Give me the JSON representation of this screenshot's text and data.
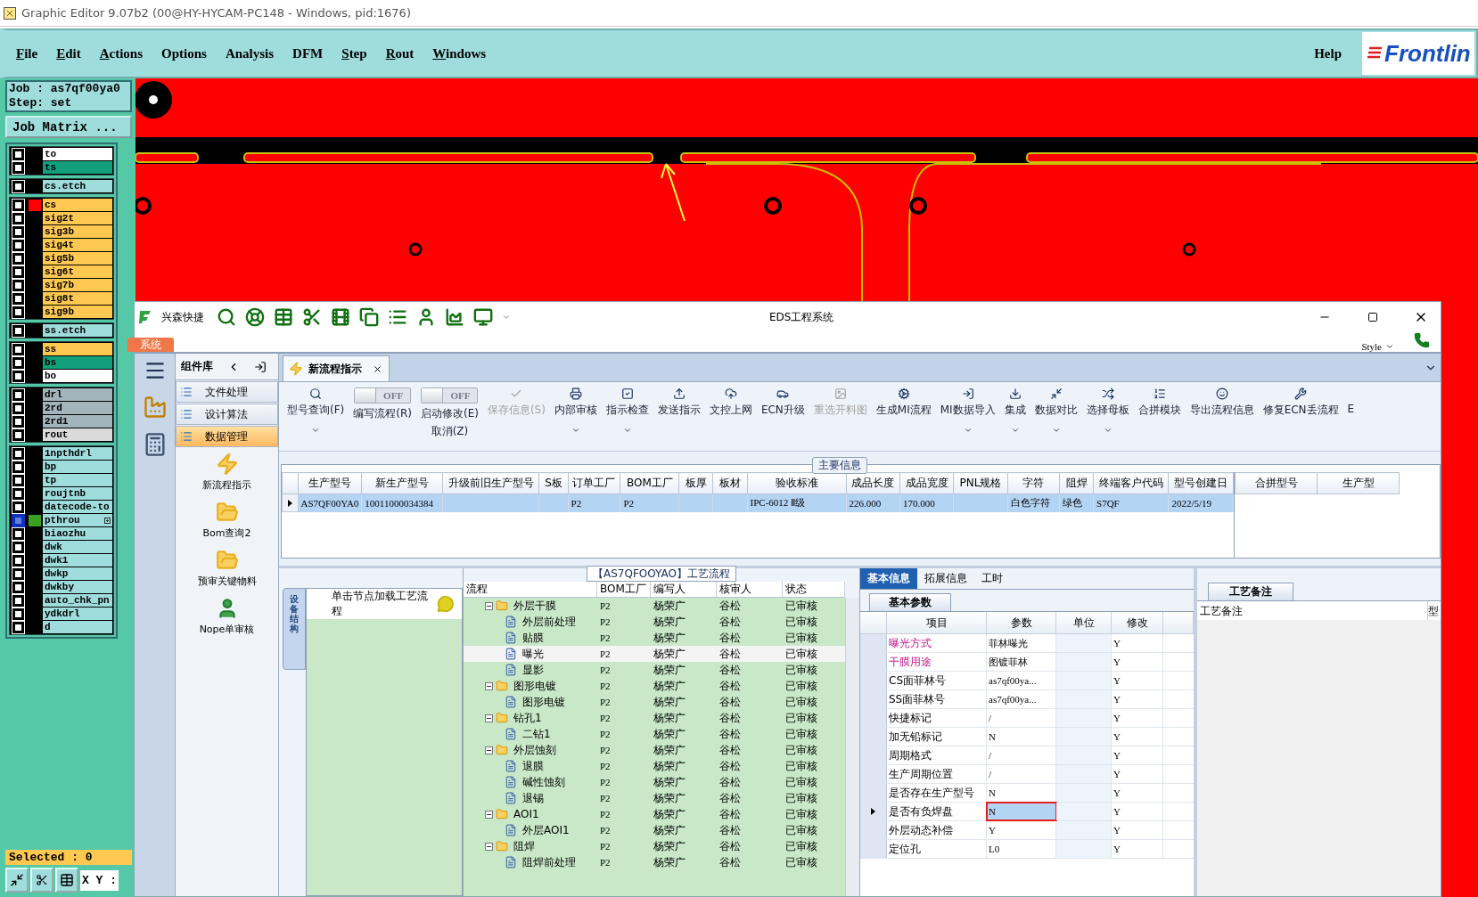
{
  "window": {
    "title": "Graphic Editor 9.07b2 (00@HY-HYCAM-PC148 - Windows, pid:1676)"
  },
  "menu": [
    {
      "label": "File",
      "mnemonic": true
    },
    {
      "label": "Edit",
      "mnemonic": true
    },
    {
      "label": "Actions",
      "mnemonic": true
    },
    {
      "label": "Options",
      "mnemonic": false
    },
    {
      "label": "Analysis",
      "mnemonic": false
    },
    {
      "label": "DFM",
      "mnemonic": false
    },
    {
      "label": "Step",
      "mnemonic": true
    },
    {
      "label": "Rout",
      "mnemonic": true
    },
    {
      "label": "Windows",
      "mnemonic": true
    }
  ],
  "help": "Help",
  "logo_text": "Frontlin",
  "job": {
    "job": "Job : as7qf00ya0",
    "step": "Step: set",
    "matrix_button": "Job Matrix ..."
  },
  "layer_groups": [
    {
      "layers": [
        {
          "name": "to",
          "color": "#ffffff",
          "selected": false
        },
        {
          "name": "ts",
          "color": "#12a07c",
          "selected": false
        }
      ]
    },
    {
      "layers": [
        {
          "name": "cs.etch",
          "color": "#9fdcdc",
          "selected": false
        }
      ]
    },
    {
      "layers": [
        {
          "name": "cs",
          "color": "#ffc850",
          "selected": false,
          "marker": {
            "color": "#ff0000"
          }
        },
        {
          "name": "sig2t",
          "color": "#ffc850",
          "selected": false
        },
        {
          "name": "sig3b",
          "color": "#ffc850",
          "selected": false
        },
        {
          "name": "sig4t",
          "color": "#ffc850",
          "selected": false
        },
        {
          "name": "sig5b",
          "color": "#ffc850",
          "selected": false
        },
        {
          "name": "sig6t",
          "color": "#ffc850",
          "selected": false
        },
        {
          "name": "sig7b",
          "color": "#ffc850",
          "selected": false
        },
        {
          "name": "sig8t",
          "color": "#ffc850",
          "selected": false
        },
        {
          "name": "sig9b",
          "color": "#ffc850",
          "selected": false
        }
      ]
    },
    {
      "layers": [
        {
          "name": "ss.etch",
          "color": "#9fdcdc",
          "selected": false
        }
      ]
    },
    {
      "layers": [
        {
          "name": "ss",
          "color": "#ffc850",
          "selected": false
        },
        {
          "name": "bs",
          "color": "#12a07c",
          "selected": false
        },
        {
          "name": "bo",
          "color": "#ffffff",
          "selected": false
        }
      ]
    },
    {
      "layers": [
        {
          "name": "drl",
          "color": "#a4b4bc",
          "selected": false
        },
        {
          "name": "2rd",
          "color": "#a4b4bc",
          "selected": false
        },
        {
          "name": "2rd1",
          "color": "#a4b4bc",
          "selected": false
        },
        {
          "name": "rout",
          "color": "#dadada",
          "selected": false
        }
      ]
    },
    {
      "layers": [
        {
          "name": "1npthdrl",
          "color": "#9fdcdc",
          "selected": false
        },
        {
          "name": "bp",
          "color": "#9fdcdc",
          "selected": false
        },
        {
          "name": "tp",
          "color": "#9fdcdc",
          "selected": false
        },
        {
          "name": "roujtnb",
          "color": "#9fdcdc",
          "selected": false
        },
        {
          "name": "datecode-to",
          "color": "#9fdcdc",
          "selected": false
        },
        {
          "name": "pthrou",
          "color": "#9fdcdc",
          "selected": true,
          "marker": {
            "color": "#3aa020"
          }
        },
        {
          "name": "biaozhu",
          "color": "#9fdcdc",
          "selected": false
        },
        {
          "name": "dwk",
          "color": "#9fdcdc",
          "selected": false
        },
        {
          "name": "dwk1",
          "color": "#9fdcdc",
          "selected": false
        },
        {
          "name": "dwkp",
          "color": "#9fdcdc",
          "selected": false
        },
        {
          "name": "dwkby",
          "color": "#9fdcdc",
          "selected": false
        },
        {
          "name": "auto_chk_pn",
          "color": "#9fdcdc",
          "selected": false
        },
        {
          "name": "ydkdrl",
          "color": "#9fdcdc",
          "selected": false
        },
        {
          "name": "d",
          "color": "#9fdcdc",
          "selected": false
        }
      ]
    }
  ],
  "selected_count": "Selected : 0",
  "xy_label": "X Y :",
  "eds": {
    "title": "EDS工程系统",
    "quick_access": "兴森快捷",
    "system_tab": "系统",
    "style_menu": "Style",
    "component_panel": {
      "title": "组件库",
      "categories": [
        {
          "label": "文件处理",
          "selected": false
        },
        {
          "label": "设计算法",
          "selected": false
        },
        {
          "label": "数据管理",
          "selected": true
        }
      ],
      "tools": [
        {
          "label": "新流程指示"
        },
        {
          "label": "Bom查询2"
        },
        {
          "label": "预审关键物料"
        },
        {
          "label": "Nope单审核"
        }
      ]
    },
    "doc_tab": {
      "label": "新流程指示"
    },
    "ribbon": [
      {
        "kind": "button",
        "label": "型号查询(F)",
        "disabled": false,
        "dropdown": true
      },
      {
        "kind": "toggle",
        "label": "编写流程(R)",
        "toggle_text": "OFF",
        "on": false
      },
      {
        "kind": "toggle",
        "label": "启动修改(E)",
        "label2": "取消(Z)",
        "toggle_text": "OFF",
        "on": false
      },
      {
        "kind": "button",
        "label": "保存信息(S)",
        "disabled": true,
        "dropdown": false
      },
      {
        "kind": "button",
        "label": "内部审核",
        "disabled": false,
        "dropdown": true
      },
      {
        "kind": "button",
        "label": "指示检查",
        "disabled": false,
        "dropdown": true
      },
      {
        "kind": "button",
        "label": "发送指示",
        "disabled": false,
        "dropdown": false
      },
      {
        "kind": "button",
        "label": "文控上网",
        "disabled": false,
        "dropdown": false
      },
      {
        "kind": "button",
        "label": "ECN升级",
        "disabled": false,
        "dropdown": false
      },
      {
        "kind": "button",
        "label": "重选开料图",
        "disabled": true,
        "dropdown": false
      },
      {
        "kind": "button",
        "label": "生成MI流程",
        "disabled": false,
        "dropdown": false
      },
      {
        "kind": "button",
        "label": "MI数据导入",
        "disabled": false,
        "dropdown": true
      },
      {
        "kind": "button",
        "label": "集成",
        "disabled": false,
        "dropdown": true
      },
      {
        "kind": "button",
        "label": "数据对比",
        "disabled": false,
        "dropdown": true
      },
      {
        "kind": "button",
        "label": "选择母板",
        "disabled": false,
        "dropdown": true
      },
      {
        "kind": "button",
        "label": "合拼模块",
        "disabled": false,
        "dropdown": false
      },
      {
        "kind": "button",
        "label": "导出流程信息",
        "disabled": false,
        "dropdown": false
      },
      {
        "kind": "button",
        "label": "修复ECN丢流程",
        "disabled": false,
        "dropdown": false
      },
      {
        "kind": "button",
        "label": "E",
        "disabled": false,
        "dropdown": false
      }
    ],
    "main_info": {
      "title": "主要信息",
      "columns": [
        "生产型号",
        "新生产型号",
        "升级前旧生产型号",
        "S板",
        "订单工厂",
        "BOM工厂",
        "板厚",
        "板材",
        "验收标准",
        "成品长度",
        "成品宽度",
        "PNL规格",
        "字符",
        "阻焊",
        "终端客户代码",
        "型号创建日"
      ],
      "rows": [
        {
          "selected": true,
          "cells": [
            "AS7QF00YA0",
            "10011000034384",
            null,
            null,
            "P2",
            "P2",
            null,
            null,
            "IPC-6012 Ⅱ级",
            "226.000",
            "170.000",
            null,
            "白色字符",
            "绿色",
            "S7QF",
            "2022/5/19"
          ]
        }
      ],
      "side_columns": [
        "合拼型号",
        "生产型"
      ]
    },
    "device_panel": {
      "tab": "设备结构",
      "hint": "单击节点加载工艺流程"
    },
    "process_tree": {
      "title": "【AS7QFOOYAO】工艺流程",
      "columns": [
        "流程",
        "BOM工厂",
        "编写人",
        "核审人",
        "状态"
      ],
      "rows": [
        {
          "name": "外层干膜",
          "bom": "P2",
          "writer": "杨荣广",
          "checker": "谷松",
          "status": "已审核",
          "expanded": true,
          "selected": false,
          "children": [
            {
              "name": "外层前处理",
              "bom": "P2",
              "writer": "杨荣广",
              "checker": "谷松",
              "status": "已审核",
              "selected": false
            },
            {
              "name": "贴膜",
              "bom": "P2",
              "writer": "杨荣广",
              "checker": "谷松",
              "status": "已审核",
              "selected": false
            },
            {
              "name": "曝光",
              "bom": "P2",
              "writer": "杨荣广",
              "checker": "谷松",
              "status": "已审核",
              "selected": true
            },
            {
              "name": "显影",
              "bom": "P2",
              "writer": "杨荣广",
              "checker": "谷松",
              "status": "已审核",
              "selected": false
            }
          ]
        },
        {
          "name": "图形电镀",
          "bom": "P2",
          "writer": "杨荣广",
          "checker": "谷松",
          "status": "已审核",
          "expanded": true,
          "selected": false,
          "children": [
            {
              "name": "图形电镀",
              "bom": "P2",
              "writer": "杨荣广",
              "checker": "谷松",
              "status": "已审核",
              "selected": false
            }
          ]
        },
        {
          "name": "钻孔1",
          "bom": "P2",
          "writer": "杨荣广",
          "checker": "谷松",
          "status": "已审核",
          "expanded": true,
          "selected": false,
          "children": [
            {
              "name": "二钻1",
              "bom": "P2",
              "writer": "杨荣广",
              "checker": "谷松",
              "status": "已审核",
              "selected": false
            }
          ]
        },
        {
          "name": "外层蚀刻",
          "bom": "P2",
          "writer": "杨荣广",
          "checker": "谷松",
          "status": "已审核",
          "expanded": true,
          "selected": false,
          "children": [
            {
              "name": "退膜",
              "bom": "P2",
              "writer": "杨荣广",
              "checker": "谷松",
              "status": "已审核",
              "selected": false
            },
            {
              "name": "碱性蚀刻",
              "bom": "P2",
              "writer": "杨荣广",
              "checker": "谷松",
              "status": "已审核",
              "selected": false
            },
            {
              "name": "退锡",
              "bom": "P2",
              "writer": "杨荣广",
              "checker": "谷松",
              "status": "已审核",
              "selected": false
            }
          ]
        },
        {
          "name": "AOI1",
          "bom": "P2",
          "writer": "杨荣广",
          "checker": "谷松",
          "status": "已审核",
          "expanded": true,
          "selected": false,
          "children": [
            {
              "name": "外层AOI1",
              "bom": "P2",
              "writer": "杨荣广",
              "checker": "谷松",
              "status": "已审核",
              "selected": false
            }
          ]
        },
        {
          "name": "阻焊",
          "bom": "P2",
          "writer": "杨荣广",
          "checker": "谷松",
          "status": "已审核",
          "expanded": true,
          "selected": false,
          "children": [
            {
              "name": "阻焊前处理",
              "bom": "P2",
              "writer": "杨荣广",
              "checker": "谷松",
              "status": "已审核",
              "selected": false
            }
          ]
        }
      ]
    },
    "info_tabs": [
      {
        "label": "基本信息",
        "selected": true
      },
      {
        "label": "拓展信息",
        "selected": false
      },
      {
        "label": "工时",
        "selected": false
      }
    ],
    "params": {
      "tab": "基本参数",
      "columns": [
        "项目",
        "参数",
        "单位",
        "修改"
      ],
      "rows": [
        {
          "item": "曝光方式",
          "value": "菲林曝光",
          "modify": "Y",
          "highlight": true,
          "selected": false
        },
        {
          "item": "干膜用途",
          "value": "图镀菲林",
          "modify": "Y",
          "highlight": true,
          "selected": false
        },
        {
          "item": "CS面菲林号",
          "value": "as7qf00ya...",
          "modify": "Y",
          "highlight": false,
          "selected": false
        },
        {
          "item": "SS面菲林号",
          "value": "as7qf00ya...",
          "modify": "Y",
          "highlight": false,
          "selected": false
        },
        {
          "item": "快捷标记",
          "value": "/",
          "modify": "Y",
          "highlight": false,
          "selected": false
        },
        {
          "item": "加无铅标记",
          "value": "N",
          "modify": "Y",
          "highlight": false,
          "selected": false
        },
        {
          "item": "周期格式",
          "value": "/",
          "modify": "Y",
          "highlight": false,
          "selected": false
        },
        {
          "item": "生产周期位置",
          "value": "/",
          "modify": "Y",
          "highlight": false,
          "selected": false
        },
        {
          "item": "是否存在生产型号",
          "value": "N",
          "modify": "Y",
          "highlight": false,
          "selected": false
        },
        {
          "item": "是否有负焊盘",
          "value": "N",
          "modify": "Y",
          "highlight": false,
          "selected": true
        },
        {
          "item": "外层动态补偿",
          "value": "Y",
          "modify": "Y",
          "highlight": false,
          "selected": false
        },
        {
          "item": "定位孔",
          "value": "L0",
          "modify": "Y",
          "highlight": false,
          "selected": false
        }
      ]
    },
    "notes": {
      "tab": "工艺备注",
      "header": "工艺备注",
      "side_header": "型"
    }
  }
}
